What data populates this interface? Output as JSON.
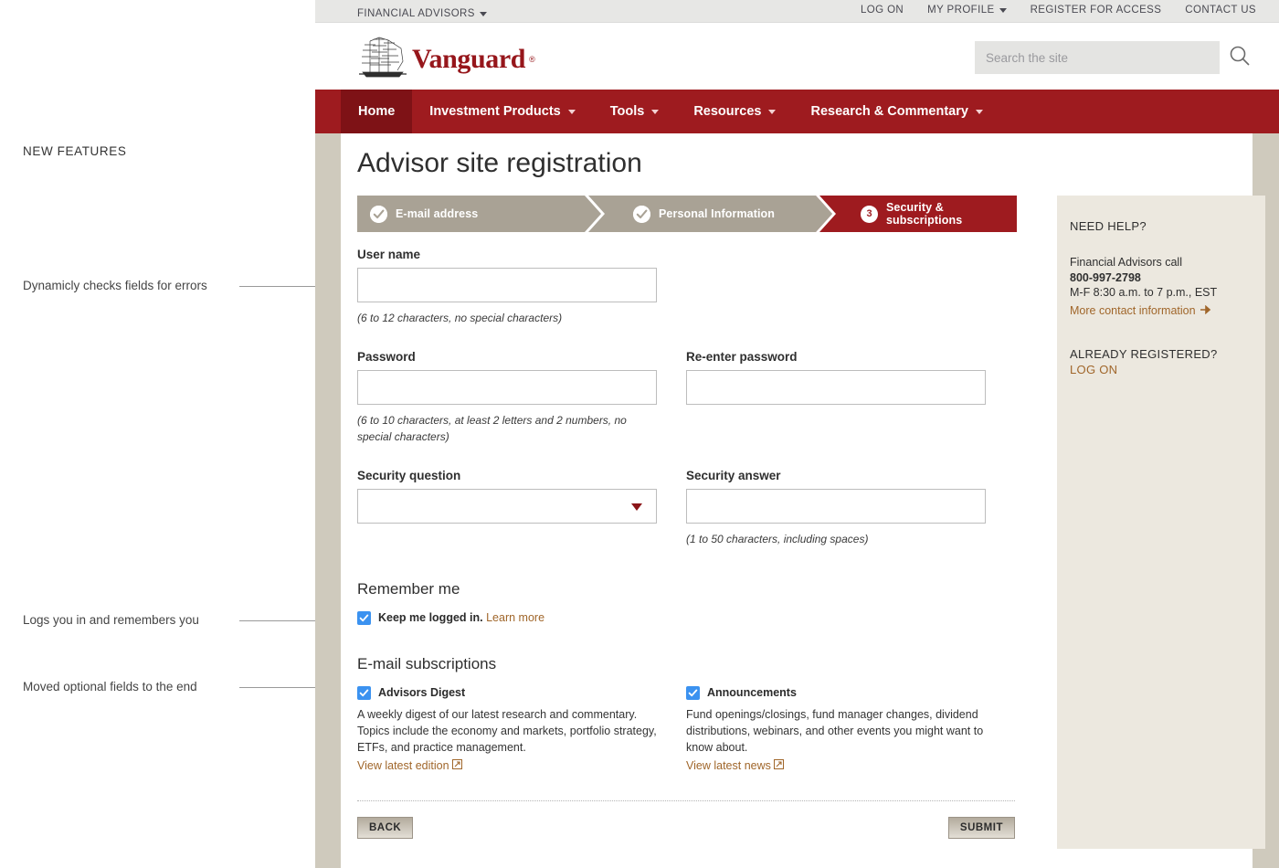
{
  "annotations": {
    "section_title": "NEW FEATURES",
    "items": [
      {
        "text": "Dynamicly checks fields for errors"
      },
      {
        "text": "Logs you in and remembers you"
      },
      {
        "text": "Moved optional fields to the end"
      }
    ]
  },
  "utility_bar": {
    "audience_label": "FINANCIAL ADVISORS",
    "links": [
      {
        "label": "LOG ON",
        "caret": false
      },
      {
        "label": "MY PROFILE",
        "caret": true
      },
      {
        "label": "REGISTER FOR ACCESS",
        "caret": false
      },
      {
        "label": "CONTACT US",
        "caret": false
      }
    ]
  },
  "masthead": {
    "logo_text": "Vanguard",
    "logo_trademark": "®",
    "logo_icon": "sailing-ship-icon",
    "search": {
      "placeholder": "Search the site",
      "value": "",
      "icon": "search-icon"
    }
  },
  "main_nav": {
    "items": [
      {
        "label": "Home",
        "caret": false,
        "active": true
      },
      {
        "label": "Investment Products",
        "caret": true,
        "active": false
      },
      {
        "label": "Tools",
        "caret": true,
        "active": false
      },
      {
        "label": "Resources",
        "caret": true,
        "active": false
      },
      {
        "label": "Research & Commentary",
        "caret": true,
        "active": false
      }
    ]
  },
  "page": {
    "title": "Advisor site registration"
  },
  "steps": [
    {
      "label": "E-mail address",
      "state": "done",
      "marker": "check-icon"
    },
    {
      "label": "Personal Information",
      "state": "done",
      "marker": "check-icon"
    },
    {
      "label": "Security & subscriptions",
      "state": "current",
      "marker": "3"
    }
  ],
  "form": {
    "username": {
      "label": "User name",
      "value": "",
      "help": "(6 to 12 characters, no special characters)"
    },
    "password": {
      "label": "Password",
      "value": "",
      "help": "(6 to 10 characters, at least 2 letters and 2 numbers, no special characters)"
    },
    "reenter_password": {
      "label": "Re-enter password",
      "value": ""
    },
    "security_question": {
      "label": "Security question",
      "value": "",
      "icon": "chevron-down-icon",
      "options": []
    },
    "security_answer": {
      "label": "Security answer",
      "value": "",
      "help": "(1 to 50 characters, including spaces)"
    },
    "remember_me": {
      "heading": "Remember me",
      "checkbox_label": "Keep me logged in.",
      "link_label": "Learn more",
      "checked": true
    },
    "subscriptions": {
      "heading": "E-mail subscriptions",
      "items": [
        {
          "label": "Advisors Digest",
          "checked": true,
          "description": "A weekly digest of our latest research and commentary. Topics include the economy and markets, portfolio strategy, ETFs, and practice management.",
          "link_label": "View latest edition",
          "link_icon": "external-link-icon"
        },
        {
          "label": "Announcements",
          "checked": true,
          "description": "Fund openings/closings, fund manager changes, dividend distributions, webinars, and other events you might want to know about.",
          "link_label": "View latest news",
          "link_icon": "external-link-icon"
        }
      ]
    },
    "buttons": {
      "back": "BACK",
      "submit": "SUBMIT"
    }
  },
  "help_panel": {
    "need_help_heading": "NEED HELP?",
    "call_line": "Financial Advisors call",
    "phone": "800-997-2798",
    "hours": "M-F 8:30 a.m. to 7 p.m., EST",
    "more_contact_label": "More contact information",
    "more_contact_icon": "arrow-right-icon",
    "already_registered_heading": "ALREADY REGISTERED?",
    "log_on_label": "LOG ON"
  },
  "colors": {
    "brand_red": "#9e1b1f",
    "brand_red_dark": "#7e1216",
    "link_orange": "#a0662a",
    "step_done": "#a9a295",
    "checkbox_blue": "#3b92f0",
    "panel_beige": "#ece8df",
    "frame_tan": "#cfcabd"
  }
}
